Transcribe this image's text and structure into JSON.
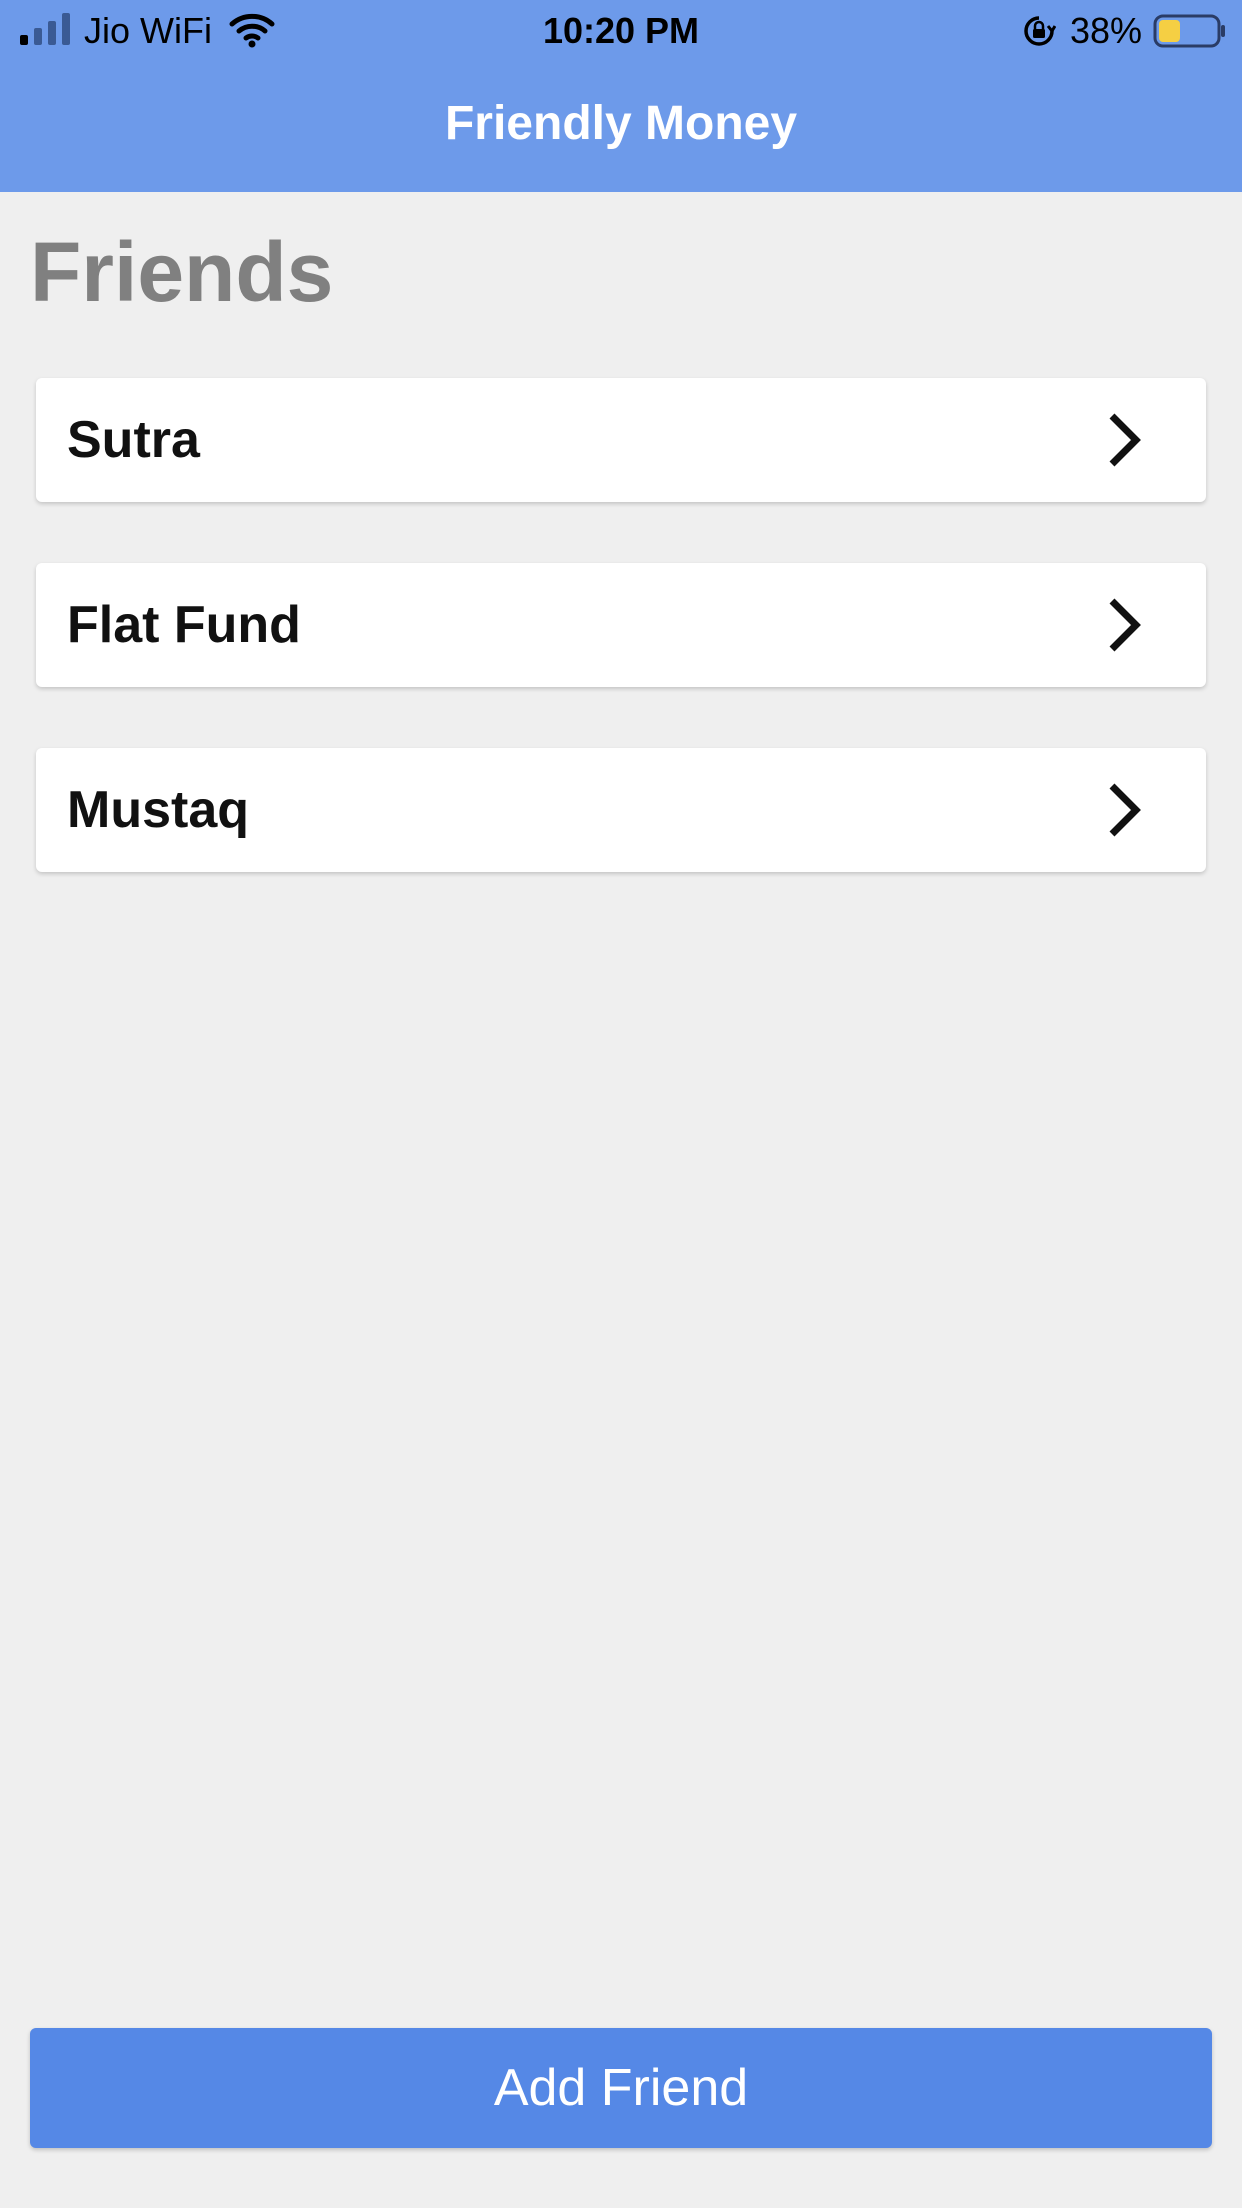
{
  "status_bar": {
    "carrier": "Jio WiFi",
    "time": "10:20 PM",
    "battery_percent": "38%",
    "signal_icon": "signal-bars-icon",
    "wifi_icon": "wifi-icon",
    "rotation_lock_icon": "rotation-lock-icon",
    "battery_icon": "battery-icon",
    "battery_level": 0.38,
    "battery_fill_color": "#f5cf43"
  },
  "header": {
    "title": "Friendly Money",
    "background_color": "#6d9aea"
  },
  "main": {
    "section_title": "Friends",
    "friends": [
      {
        "name": "Sutra",
        "icon": "chevron-right-icon"
      },
      {
        "name": "Flat Fund",
        "icon": "chevron-right-icon"
      },
      {
        "name": "Mustaq",
        "icon": "chevron-right-icon"
      }
    ]
  },
  "footer": {
    "add_button_label": "Add Friend",
    "button_color": "#5588e6"
  }
}
